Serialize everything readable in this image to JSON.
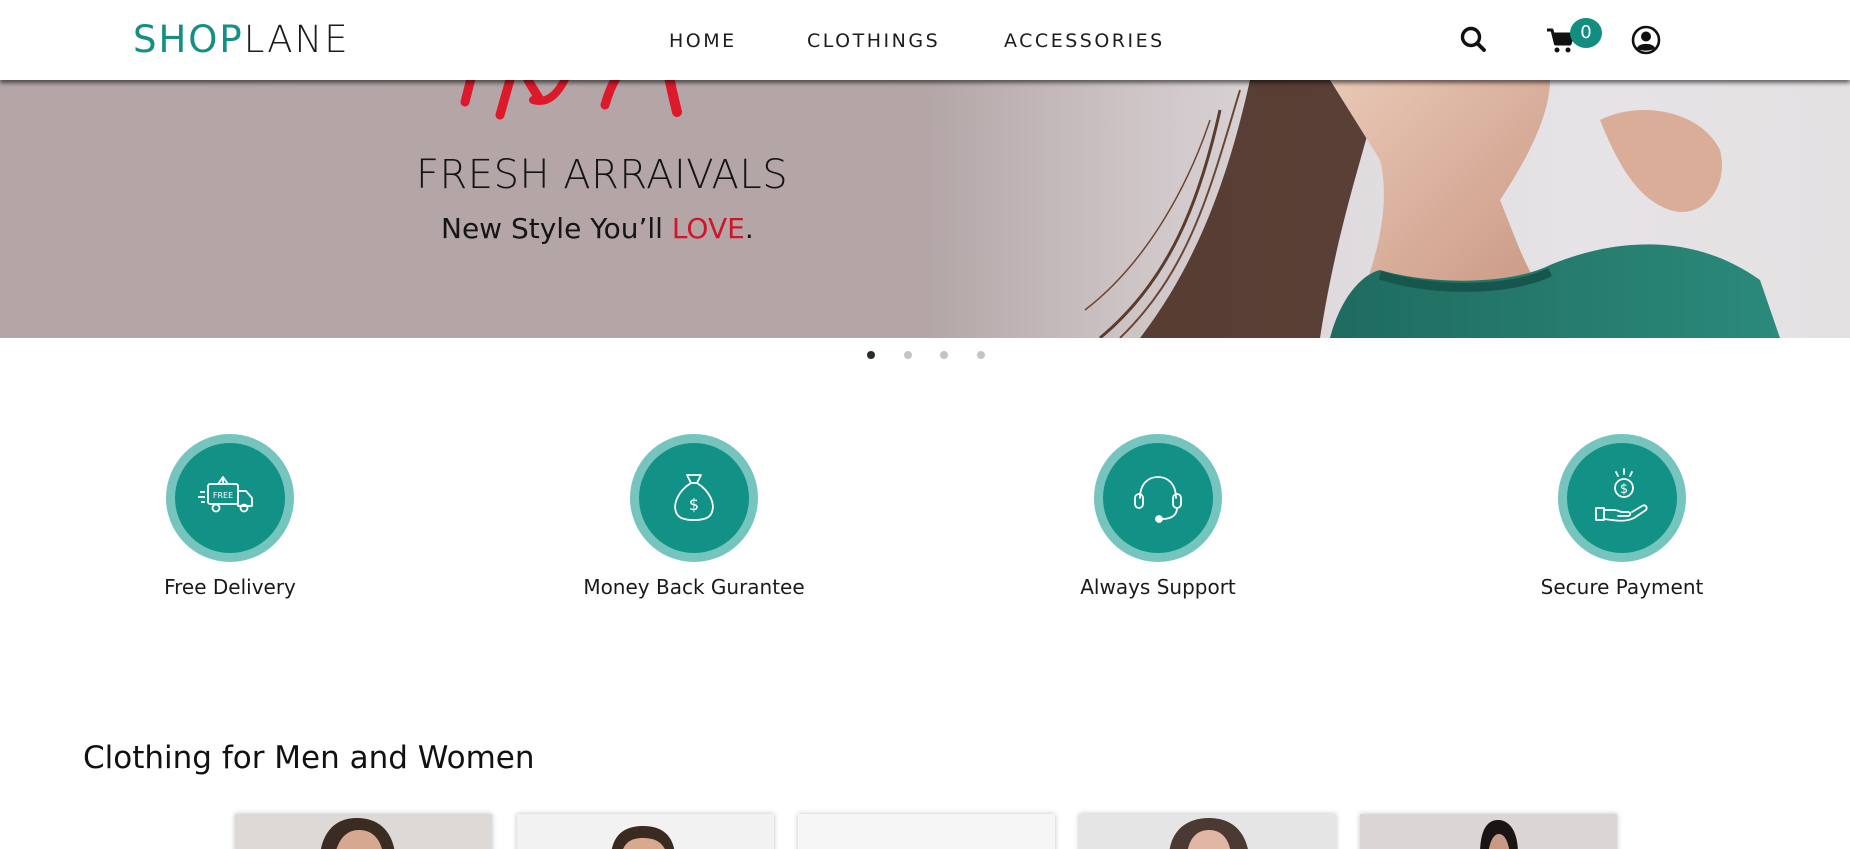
{
  "header": {
    "logo_part1": "SHOP",
    "logo_part2": "LANE",
    "nav": [
      "HOME",
      "CLOTHINGS",
      "ACCESSORIES"
    ],
    "cart_count": "0",
    "icons": [
      "search-icon",
      "cart-icon",
      "user-icon"
    ]
  },
  "hero": {
    "title": "FRESH ARRAIVALS",
    "subtitle_prefix": "New Style You’ll ",
    "subtitle_highlight": "LOVE",
    "subtitle_suffix": ".",
    "highlight_color": "#d0162a"
  },
  "carousel": {
    "slides": 4,
    "active_index": 0
  },
  "features": [
    {
      "label": "Free Delivery",
      "icon": "delivery-truck-icon"
    },
    {
      "label": "Money Back Gurantee",
      "icon": "money-bag-icon"
    },
    {
      "label": "Always Support",
      "icon": "headset-icon"
    },
    {
      "label": "Secure Payment",
      "icon": "coin-hand-icon"
    }
  ],
  "free_badge_text": "FREE",
  "section": {
    "title": "Clothing for Men and Women"
  },
  "colors": {
    "brand": "#148f85",
    "accent_red": "#d0162a",
    "feature_circle": "#129286"
  }
}
